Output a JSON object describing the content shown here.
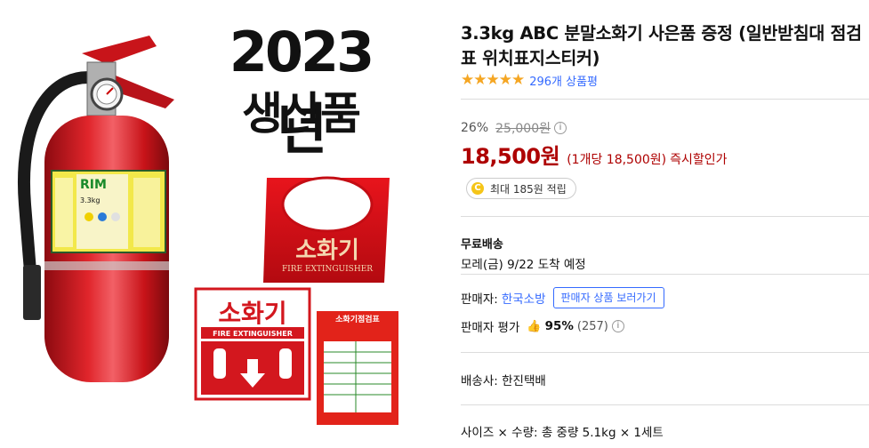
{
  "image": {
    "headline_year": "2023년",
    "headline_made": "생산품",
    "extinguisher_brand": "RIM",
    "extinguisher_weight": "3.3kg",
    "stand_label": "소화기",
    "stand_label_en": "FIRE EXTINGUISHER",
    "sign_label": "소화기",
    "sign_label_en": "FIRE EXTINGUISHER",
    "card_title": "소화기점검표"
  },
  "product": {
    "title": "3.3kg ABC 분말소화기 사은품 증정 (일반받침대 점검표 위치표지스티커)",
    "stars": "★★★★★",
    "review_count": "296개 상품평"
  },
  "price": {
    "discount_rate": "26%",
    "original_price": "25,000원",
    "sale_price": "18,500원",
    "unit_price": "(1개당 18,500원)",
    "instant_discount": "즉시할인가",
    "info_glyph": "i"
  },
  "reward": {
    "coin_glyph": "C",
    "text": "최대 185원 적립"
  },
  "shipping": {
    "label": "무료배송",
    "eta": "모레(금) 9/22 도착 예정"
  },
  "seller": {
    "label": "판매자:",
    "name": "한국소방",
    "store_button": "판매자 상품 보러가기",
    "rating_label": "판매자 평가",
    "rating_pct": "95%",
    "rating_count": "(257)"
  },
  "delivery": {
    "carrier": "배송사: 한진택배"
  },
  "option": {
    "text": "사이즈 × 수량: 총 중량 5.1kg × 1세트"
  },
  "colors": {
    "price_red": "#ae0000",
    "link_blue": "#346aff",
    "star_yellow": "#f5a623",
    "extinguisher_red": "#d3171e"
  }
}
